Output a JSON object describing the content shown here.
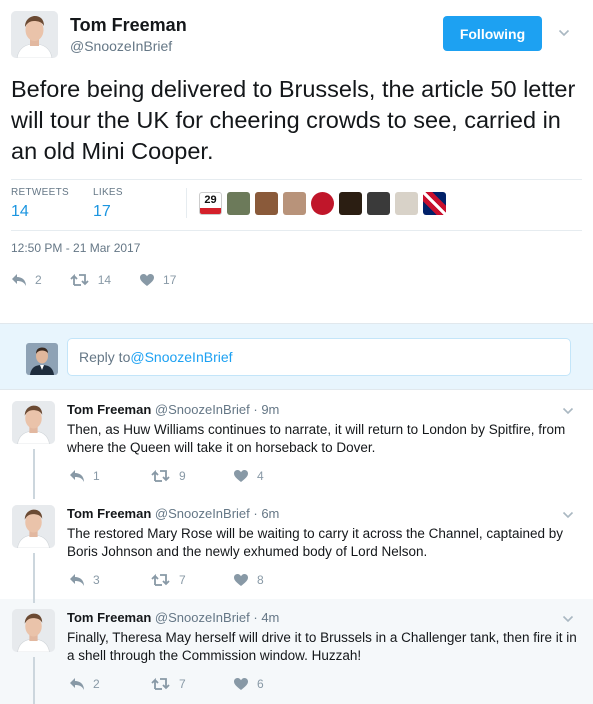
{
  "tweet": {
    "author_name": "Tom Freeman",
    "author_handle": "@SnoozeInBrief",
    "follow_label": "Following",
    "text": "Before being delivered to Brussels, the article 50 letter will tour the UK for cheering crowds to see, carried in an old Mini Cooper.",
    "retweets_label": "RETWEETS",
    "retweets_count": "14",
    "likes_label": "LIKES",
    "likes_count": "17",
    "timestamp": "12:50 PM - 21 Mar 2017",
    "actions": {
      "reply_count": "2",
      "retweet_count": "14",
      "like_count": "17"
    },
    "liker_avatar_text": "29"
  },
  "reply_box": {
    "prefix": "Reply to ",
    "mention": "@SnoozeInBrief"
  },
  "replies": [
    {
      "name": "Tom Freeman",
      "handle": "@SnoozeInBrief · 9m",
      "text": "Then, as Huw Williams continues to narrate, it will return to London by Spitfire, from where the Queen will take it on horseback to Dover.",
      "reply_count": "1",
      "retweet_count": "9",
      "like_count": "4"
    },
    {
      "name": "Tom Freeman",
      "handle": "@SnoozeInBrief · 6m",
      "text": "The restored Mary Rose will be waiting to carry it across the Channel, captained by Boris Johnson and the newly exhumed body of Lord Nelson.",
      "reply_count": "3",
      "retweet_count": "7",
      "like_count": "8"
    },
    {
      "name": "Tom Freeman",
      "handle": "@SnoozeInBrief · 4m",
      "text": "Finally, Theresa May herself will drive it to Brussels in a Challenger tank, then fire it in a shell through the Commission window. Huzzah!",
      "reply_count": "2",
      "retweet_count": "7",
      "like_count": "6"
    }
  ],
  "colors": {
    "accent": "#1da1f2",
    "link": "#1b95e0",
    "muted": "#8899a6",
    "reply_bg": "#e8f5fd"
  },
  "icons": [
    "reply-icon",
    "retweet-icon",
    "heart-icon",
    "chevron-down-icon"
  ]
}
